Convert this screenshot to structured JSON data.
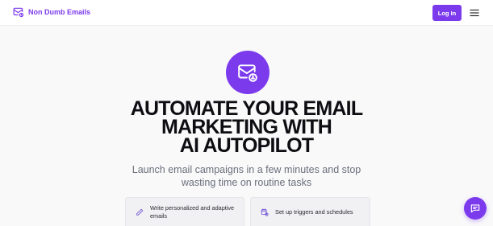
{
  "brand": {
    "name": "Non Dumb Emails",
    "logo_icon": "envelope-gear-icon",
    "accent_color": "#7c3aed"
  },
  "nav": {
    "login_label": "Log In",
    "menu_icon": "hamburger-menu-icon"
  },
  "hero": {
    "badge_icon": "envelope-gear-icon",
    "headline_lines": [
      "AUTOMATE YOUR EMAIL",
      "MARKETING WITH",
      "AI AUTOPILOT"
    ],
    "subheadline": "Launch email campaigns in a few minutes and stop wasting time on routine tasks"
  },
  "features": [
    {
      "icon": "pencil-icon",
      "label": "Write personalized and adaptive emails"
    },
    {
      "icon": "calendar-clock-icon",
      "label": "Set up triggers and schedules"
    }
  ],
  "chat": {
    "icon": "chat-bubble-icon"
  }
}
